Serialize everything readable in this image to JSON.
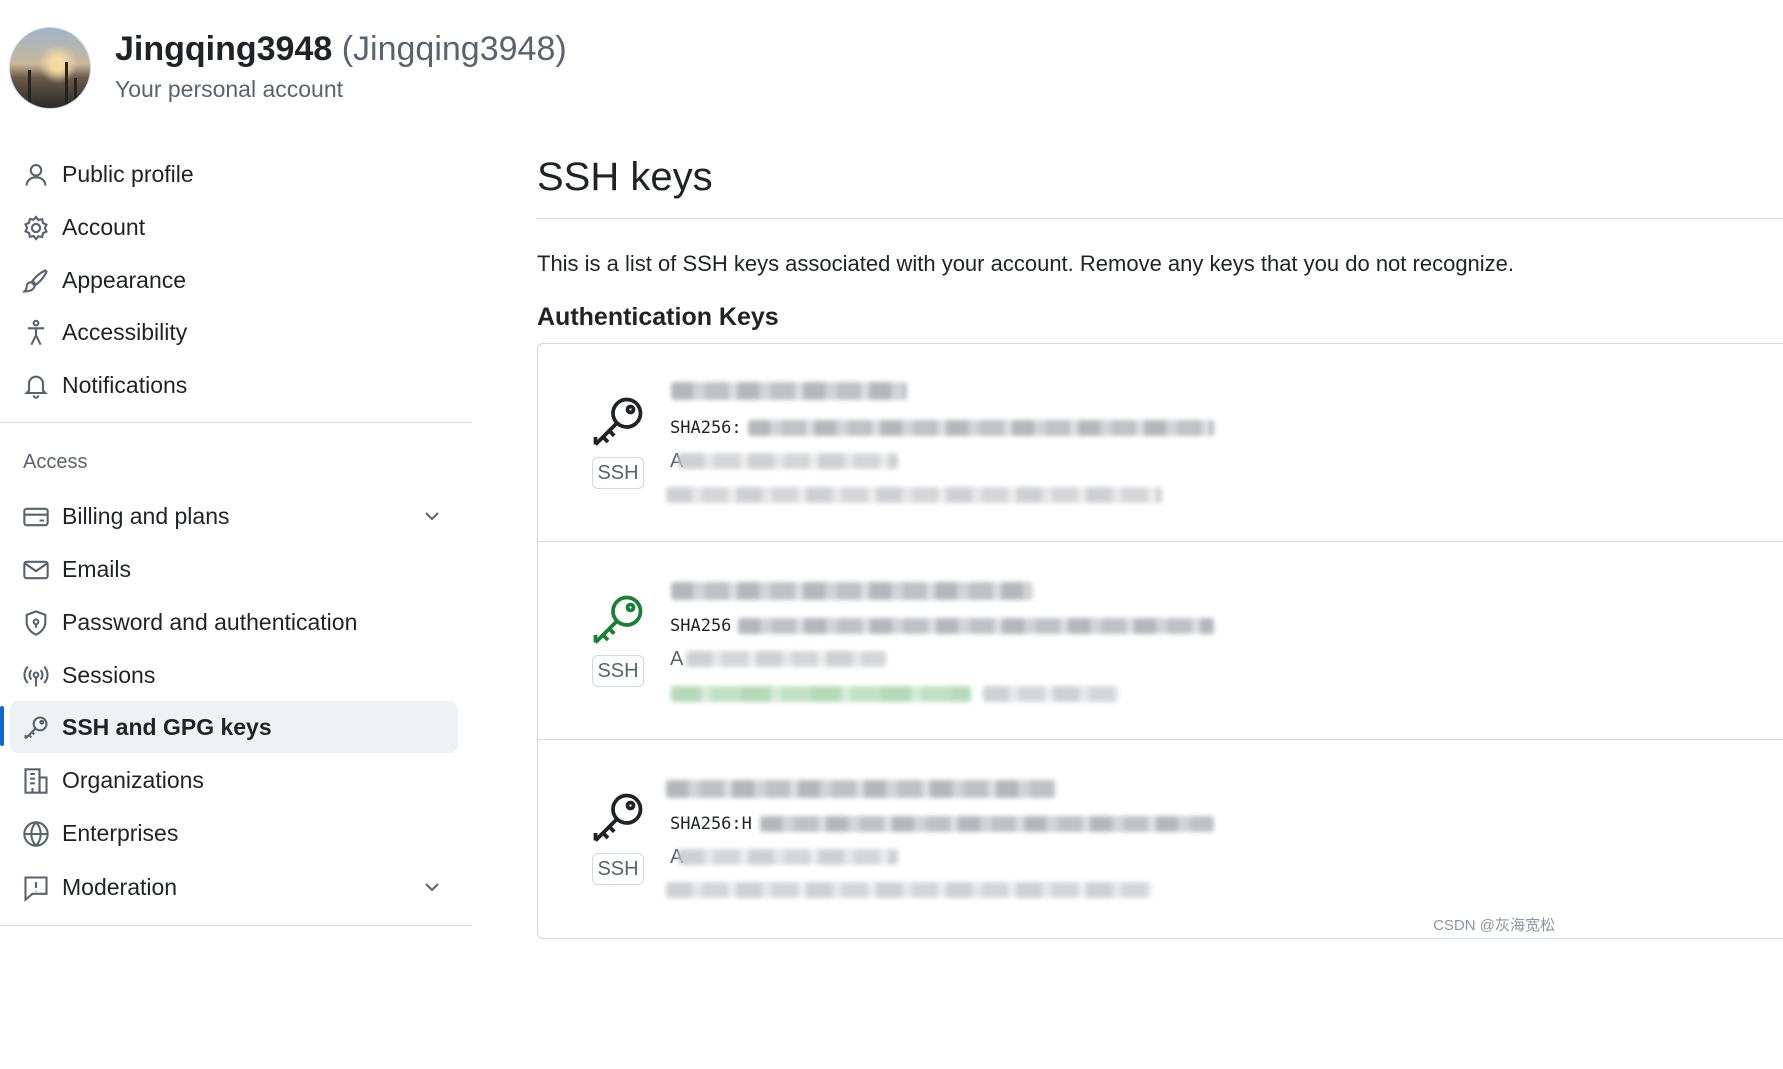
{
  "header": {
    "username": "Jingqing3948",
    "handle": "(Jingqing3948)",
    "subtitle": "Your personal account"
  },
  "sidebar": {
    "items_top": [
      {
        "label": "Public profile",
        "icon": "person-icon"
      },
      {
        "label": "Account",
        "icon": "gear-icon"
      },
      {
        "label": "Appearance",
        "icon": "paintbrush-icon"
      },
      {
        "label": "Accessibility",
        "icon": "accessibility-icon"
      },
      {
        "label": "Notifications",
        "icon": "bell-icon"
      }
    ],
    "section_heading": "Access",
    "items_access": [
      {
        "label": "Billing and plans",
        "icon": "credit-card-icon",
        "expandable": true
      },
      {
        "label": "Emails",
        "icon": "mail-icon"
      },
      {
        "label": "Password and authentication",
        "icon": "shield-icon"
      },
      {
        "label": "Sessions",
        "icon": "broadcast-icon"
      },
      {
        "label": "SSH and GPG keys",
        "icon": "key-icon",
        "active": true
      },
      {
        "label": "Organizations",
        "icon": "organization-icon"
      },
      {
        "label": "Enterprises",
        "icon": "globe-icon"
      },
      {
        "label": "Moderation",
        "icon": "report-icon",
        "expandable": true
      }
    ]
  },
  "main": {
    "title": "SSH keys",
    "description": "This is a list of SSH keys associated with your account. Remove any keys that you do not recognize.",
    "auth_heading": "Authentication Keys",
    "keys": [
      {
        "badge": "SSH",
        "fingerprint_label": "SHA256:",
        "peek_text": "A",
        "icon_color": "#1f2328"
      },
      {
        "badge": "SSH",
        "fingerprint_label": "SHA256",
        "peek_text": "A",
        "icon_color": "#1a7f37"
      },
      {
        "badge": "SSH",
        "fingerprint_label": "SHA256:H",
        "peek_text": "A",
        "icon_color": "#1f2328"
      }
    ]
  },
  "watermark": "CSDN @灰海宽松"
}
